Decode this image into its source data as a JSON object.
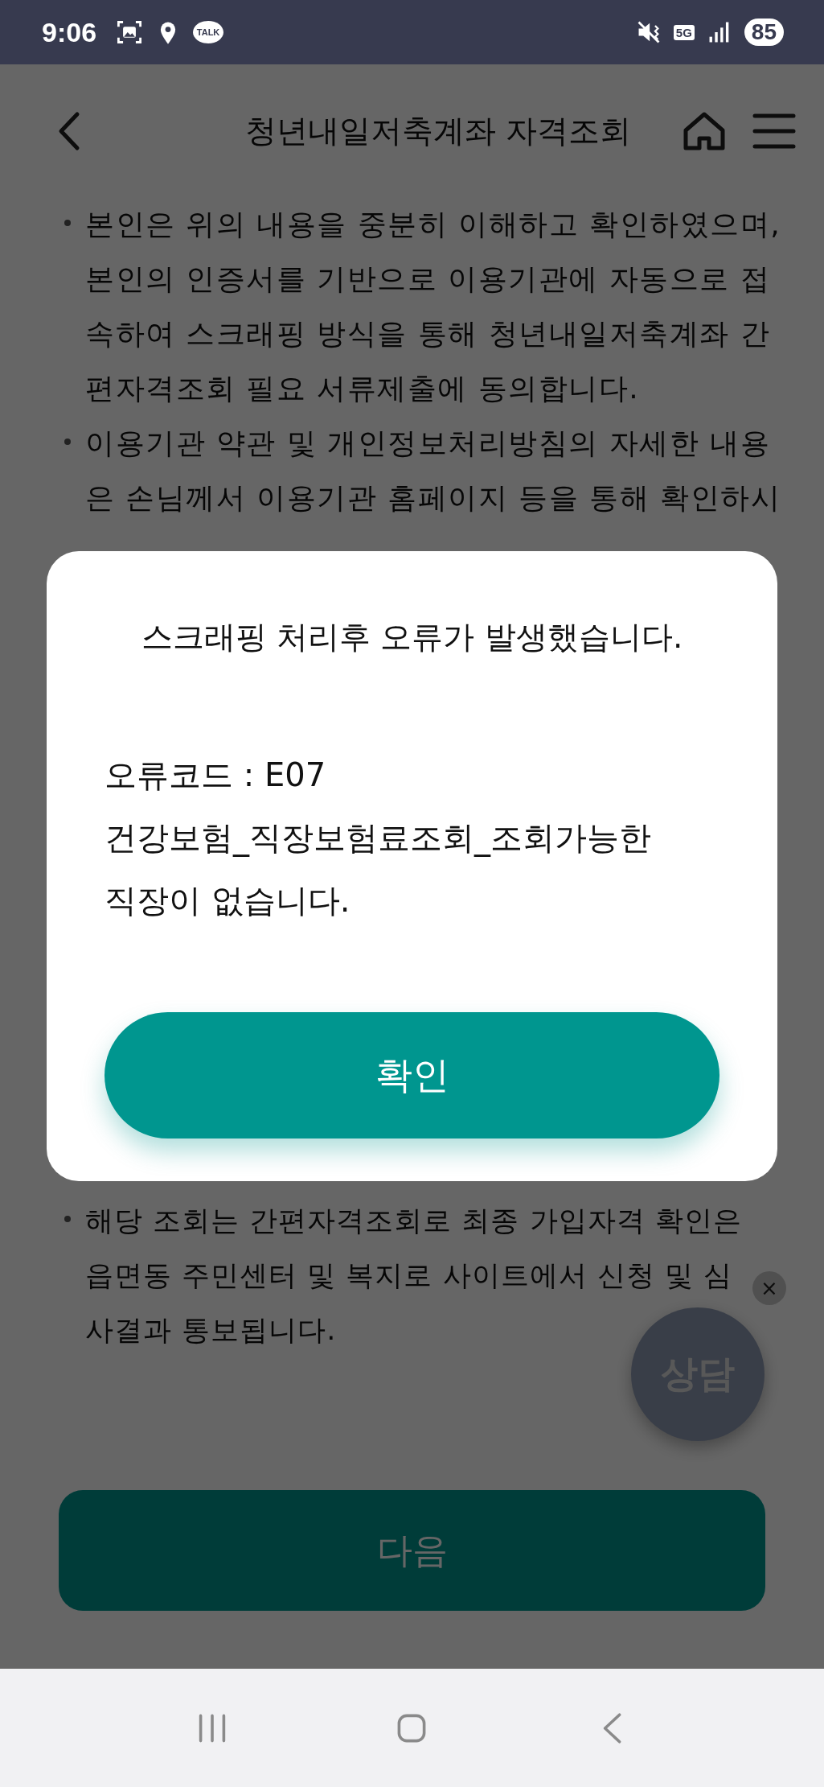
{
  "status_bar": {
    "time": "9:06",
    "talk_badge": "TALK",
    "network": "5G",
    "battery": "85"
  },
  "header": {
    "title": "청년내일저축계좌 자격조회"
  },
  "notes_top": [
    "본인은 위의 내용을 중분히 이해하고 확인하였으며, 본인의 인증서를 기반으로 이용기관에 자동으로 접속하여 스크래핑 방식을 통해 청년내일저축계좌 간편자격조회 필요 서류제출에 동의합니다.",
    "이용기관 약관 및 개인정보처리방침의 자세한 내용은 손님께서 이용기관 홈페이지 등을 통해 확인하시"
  ],
  "notes_bottom": [
    "해당 조회는 간편자격조회로 최종 가입자격 확인은 읍면동 주민센터 및 복지로 사이트에서 신청 및 심사결과 통보됩니다."
  ],
  "chat_button": {
    "label": "상담",
    "close": "×"
  },
  "next_button": {
    "label": "다음"
  },
  "dialog": {
    "title": "스크래핑 처리후 오류가 발생했습니다.",
    "code": "오류코드 : E07",
    "message": "건강보험_직장보험료조회_조회가능한 직장이 없습니다.",
    "button": "확인"
  }
}
